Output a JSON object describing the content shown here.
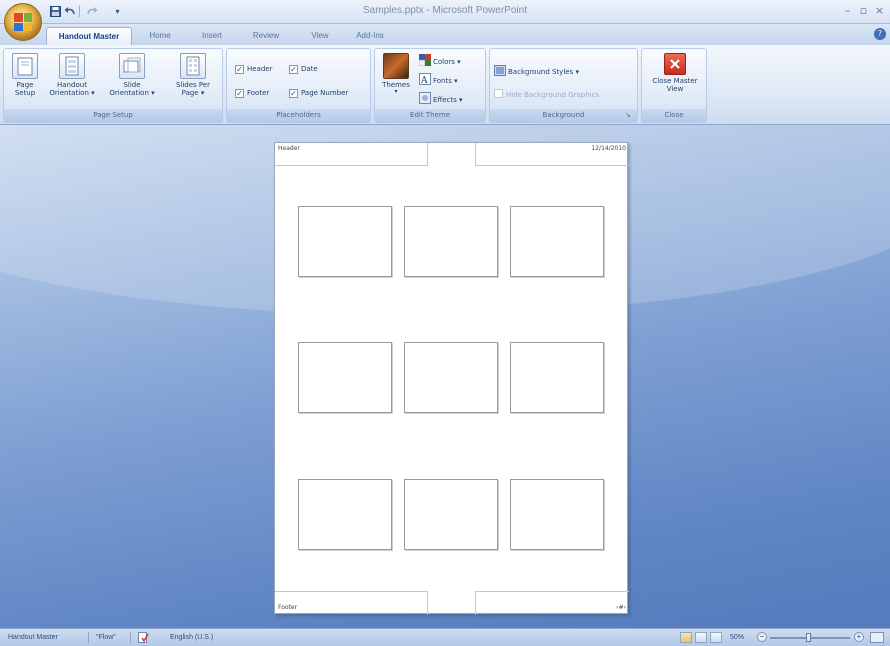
{
  "window": {
    "title": "Samples.pptx - Microsoft PowerPoint",
    "minimize_glyph": "–",
    "maximize_glyph": "▫",
    "close_glyph": "×"
  },
  "quick_access": {
    "save_icon": "save-icon",
    "undo_icon": "undo-icon",
    "redo_icon": "redo-icon",
    "customize_glyph": "▾"
  },
  "tabs": [
    {
      "label": "Handout Master",
      "active": true
    },
    {
      "label": "Home"
    },
    {
      "label": "Insert"
    },
    {
      "label": "Review"
    },
    {
      "label": "View"
    },
    {
      "label": "Add-Ins"
    }
  ],
  "ribbon": {
    "page_setup": {
      "label": "Page Setup",
      "buttons": [
        {
          "label": "Page Setup",
          "icon": "page-setup-icon"
        },
        {
          "label": "Handout Orientation ▾",
          "icon": "handout-orientation-icon"
        },
        {
          "label": "Slide Orientation ▾",
          "icon": "slide-orientation-icon"
        },
        {
          "label": "Slides Per Page ▾",
          "icon": "slides-per-page-icon"
        }
      ]
    },
    "placeholders": {
      "label": "Placeholders",
      "header": "Header",
      "date": "Date",
      "footer": "Footer",
      "page_number": "Page Number",
      "checked": [
        true,
        true,
        true,
        true
      ]
    },
    "edit_theme": {
      "label": "Edit Theme",
      "themes": "Themes",
      "colors": "Colors ▾",
      "fonts": "Fonts ▾",
      "effects": "Effects ▾"
    },
    "background": {
      "label": "Background",
      "styles": "Background Styles ▾",
      "hide_graphics": "Hide Background Graphics",
      "hide_graphics_checked": false
    },
    "close": {
      "label": "Close",
      "button": "Close Master View"
    }
  },
  "handout": {
    "header": "Header",
    "date": "12/14/2010",
    "footer": "Footer",
    "page_number": "‹#›",
    "slides_per_page": 9
  },
  "statusbar": {
    "view": "Handout Master",
    "theme": "\"Flow\"",
    "language": "English (U.S.)",
    "zoom": "50%"
  },
  "colors": {
    "accent": "#15428b",
    "workspace": "#6c8cc4",
    "close_red": "#d23b2a"
  }
}
